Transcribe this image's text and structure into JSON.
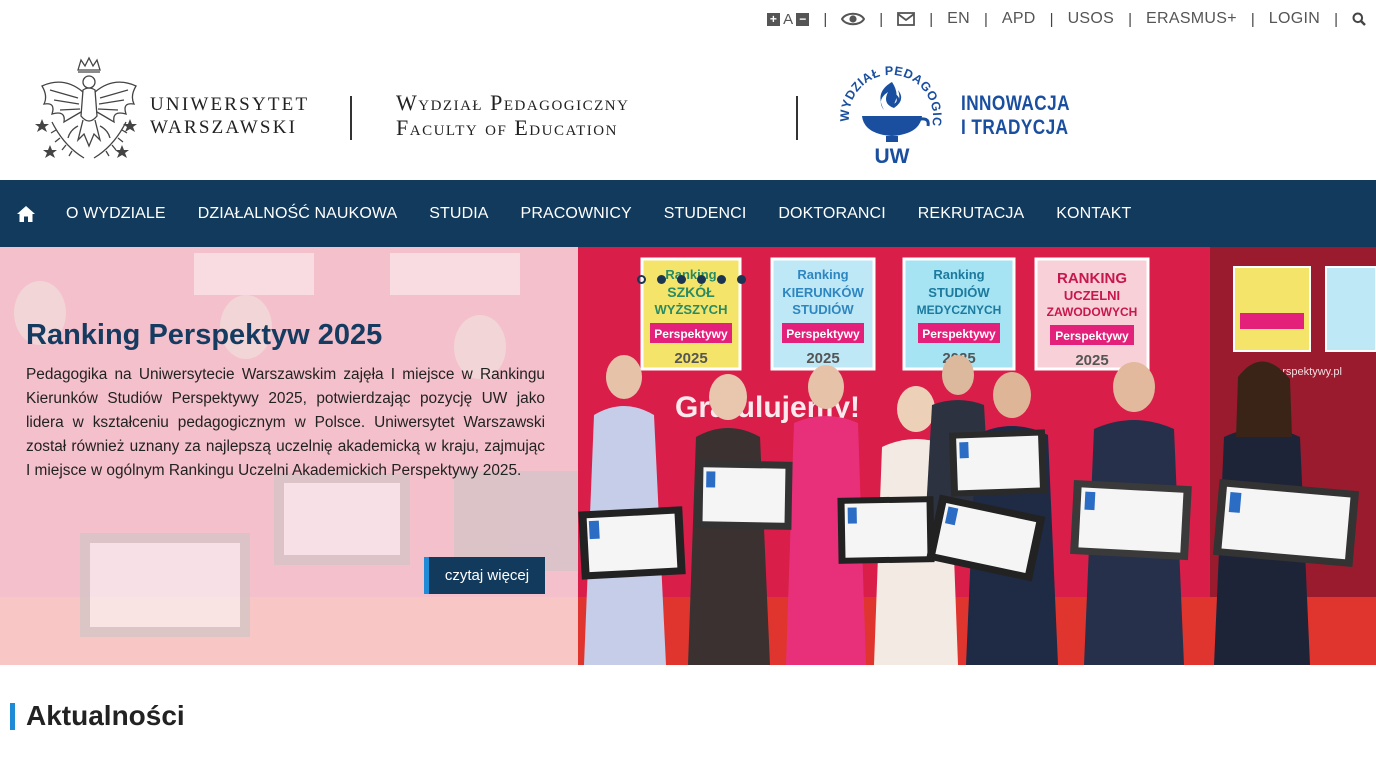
{
  "topbar": {
    "font_plus": "+",
    "font_a": "A",
    "font_minus": "−",
    "links": [
      "EN",
      "APD",
      "USOS",
      "ERASMUS+",
      "LOGIN"
    ]
  },
  "header": {
    "university_line1": "UNIWERSYTET",
    "university_line2": "WARSZAWSKI",
    "faculty_line1": "Wydział Pedagogiczny",
    "faculty_line2": "Faculty of Education",
    "logo_text_top": "WYDZIAŁ PEDAGOGICZNY",
    "logo_text_uw": "UW",
    "motto_line1": "INNOWACJA",
    "motto_line2": "I TRADYCJA"
  },
  "nav": {
    "items": [
      "O WYDZIALE",
      "DZIAŁALNOŚĆ NAUKOWA",
      "STUDIA",
      "PRACOWNICY",
      "STUDENCI",
      "DOKTORANCI",
      "REKRUTACJA",
      "KONTAKT"
    ]
  },
  "hero": {
    "title": "Ranking Perspektyw 2025",
    "text": "Pedagogika na Uniwersytecie Warszawskim zajęła I miejsce w Rankingu Kierunków Studiów Perspektywy 2025, potwierdzając pozycję UW jako lidera w kształceniu pedagogicznym w Polsce. Uniwersytet Warszawski został również uznany za najlepszą uczelnię akademicką w kraju, zajmując I miejsce w ogólnym Rankingu Uczelni Akademickich Perspektywy 2025.",
    "button": "czytaj więcej",
    "slide_count": 6,
    "active_slide": 1,
    "banners": [
      {
        "l1": "Ranking",
        "l2": "SZKÓŁ",
        "l3": "WYŻSZYCH",
        "brand": "Perspektywy",
        "year": "2025"
      },
      {
        "l1": "Ranking",
        "l2": "KIERUNKÓW",
        "l3": "STUDIÓW",
        "brand": "Perspektywy",
        "year": "2025"
      },
      {
        "l1": "Ranking",
        "l2": "STUDIÓW",
        "l3": "MEDYCZNYCH",
        "brand": "Perspektywy",
        "year": "2025"
      },
      {
        "l1": "RANKING",
        "l2": "UCZELNI",
        "l3": "ZAWODOWYCH",
        "brand": "Perspektywy",
        "year": "2025"
      }
    ],
    "photo_slogan": "Gratulujemy!",
    "photo_url_text": "perspektywy.pl"
  },
  "news": {
    "title": "Aktualności"
  },
  "colors": {
    "navy": "#113a5c",
    "accent_blue": "#1f8ad6",
    "backdrop_red": "#d81e49",
    "motto_blue": "#1a4fa0"
  }
}
